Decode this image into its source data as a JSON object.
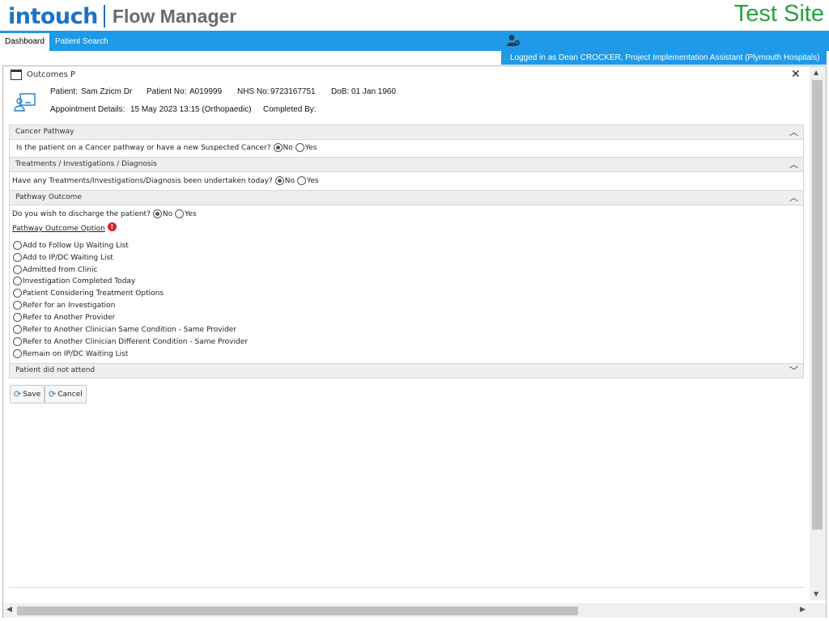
{
  "header": {
    "logo_brand": "intouch",
    "logo_product": "Flow Manager",
    "site_label": "Test Site"
  },
  "nav": {
    "tabs": [
      {
        "label": "Dashboard"
      },
      {
        "label": "Patient Search"
      }
    ],
    "login_text": "Logged in as Dean CROCKER, Project Implementation Assistant (Plymouth Hospitals)"
  },
  "dialog": {
    "title": "Outcomes P",
    "patient": {
      "patient_label": "Patient:",
      "patient_value": "Sam Zzicm Dr",
      "patient_no_label": "Patient No:",
      "patient_no_value": "A019999",
      "nhs_no_label": "NHS No:",
      "nhs_no_value": "9723167751",
      "dob_label": "DoB:",
      "dob_value": "01 Jan 1960",
      "appointment_label": "Appointment Details:",
      "appointment_value": "15 May 2023 13:15 (Orthopaedic)",
      "completed_by_label": "Completed By:",
      "completed_by_value": ""
    },
    "sections": {
      "cancer": {
        "title": "Cancer Pathway",
        "question": "Is the patient on a Cancer pathway or have a new Suspected Cancer?",
        "no_label": "No",
        "yes_label": "Yes",
        "selected": "No"
      },
      "treatments": {
        "title": "Treatments / Investigations / Diagnosis",
        "question": "Have any Treatments/Investigations/Diagnosis been undertaken today?",
        "no_label": "No",
        "yes_label": "Yes",
        "selected": "No"
      },
      "pathway": {
        "title": "Pathway Outcome",
        "question": "Do you wish to discharge the patient?",
        "no_label": "No",
        "yes_label": "Yes",
        "selected": "No",
        "option_heading": "Pathway Outcome Option",
        "required_mark": "!",
        "options": [
          "Add to Follow Up Waiting List",
          "Add to IP/DC Waiting List",
          "Admitted from Clinic",
          "Investigation Completed Today",
          "Patient Considering Treatment Options",
          "Refer for an Investigation",
          "Refer to Another Provider",
          "Refer to Another Clinician Same Condition - Same Provider",
          "Refer to Another Clinician Different Condition - Same Provider",
          "Remain on IP/DC Waiting List"
        ]
      },
      "dna": {
        "title": "Patient did not attend"
      }
    },
    "buttons": {
      "save_label": "Save",
      "cancel_label": "Cancel"
    }
  },
  "icons": {
    "accent_color": "#1e9ae8",
    "brand_color": "#1b74c5",
    "site_color": "#25a33c",
    "required_color": "#e02020"
  }
}
